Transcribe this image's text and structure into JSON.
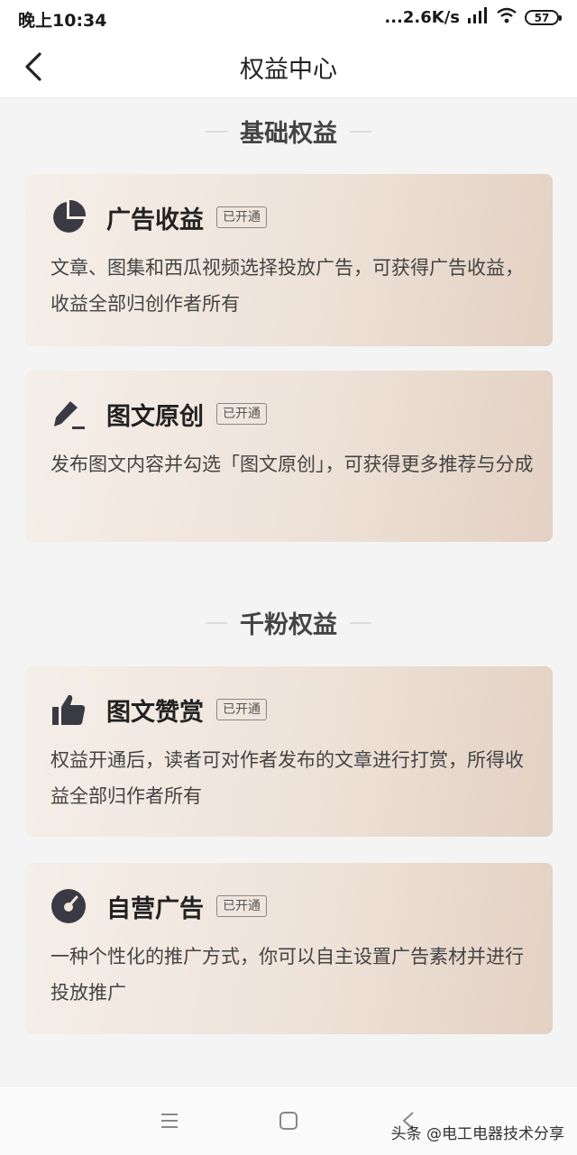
{
  "status_bar": {
    "time": "晚上10:34",
    "network_speed": "...2.6K/s",
    "battery": "57"
  },
  "nav": {
    "title": "权益中心"
  },
  "sections": [
    {
      "title": "基础权益",
      "cards": [
        {
          "icon": "pie-chart-icon",
          "title": "广告收益",
          "badge": "已开通",
          "desc": "文章、图集和西瓜视频选择投放广告，可获得广告收益，收益全部归创作者所有"
        },
        {
          "icon": "pen-icon",
          "title": "图文原创",
          "badge": "已开通",
          "desc": "发布图文内容并勾选「图文原创」，可获得更多推荐与分成"
        }
      ]
    },
    {
      "title": "千粉权益",
      "cards": [
        {
          "icon": "thumbs-up-icon",
          "title": "图文赞赏",
          "badge": "已开通",
          "desc": "权益开通后，读者可对作者发布的文章进行打赏，所得收益全部归作者所有"
        },
        {
          "icon": "gauge-icon",
          "title": "自营广告",
          "badge": "已开通",
          "desc": "一种个性化的推广方式，你可以自主设置广告素材并进行投放推广"
        }
      ]
    }
  ],
  "watermark": "头条 @电工电器技术分享",
  "colors": {
    "card_gradient_start": "#f5efe9",
    "card_gradient_end": "#e3d1c3",
    "icon_color": "#3a3a44"
  }
}
